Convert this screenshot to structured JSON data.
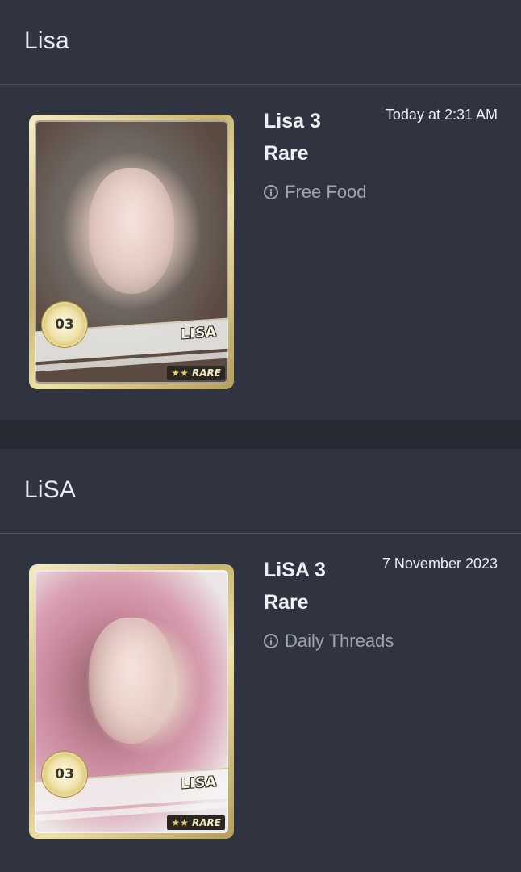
{
  "entries": [
    {
      "header": "Lisa",
      "card": {
        "name_tag": "LISA",
        "badge_number": "03",
        "rarity_stars": "★★",
        "rarity_label": "RARE"
      },
      "item_name": "Lisa 3 Rare",
      "timestamp": "Today at 2:31 AM",
      "source": "Free Food"
    },
    {
      "header": "LiSA",
      "card": {
        "name_tag": "LISA",
        "badge_number": "03",
        "rarity_stars": "★★",
        "rarity_label": "RARE"
      },
      "item_name": "LiSA 3 Rare",
      "timestamp": "7 November 2023",
      "source": "Daily Threads"
    }
  ],
  "colors": {
    "background": "#262a33",
    "panel": "#2f3440",
    "text_primary": "#eef0f3",
    "text_muted": "#9ea4b0",
    "card_gold": "#c7b46d"
  },
  "icons": {
    "source_icon": "info-circle-icon"
  }
}
